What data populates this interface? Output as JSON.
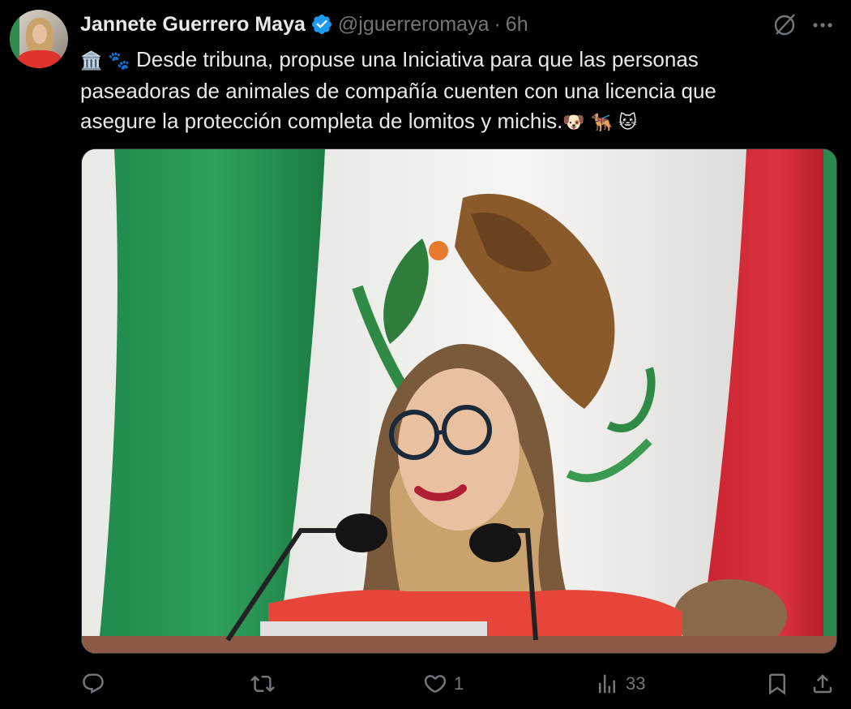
{
  "author": {
    "name": "Jannete Guerrero Maya",
    "handle": "@jguerreromaya",
    "separator": "·",
    "time": "6h"
  },
  "tweet": {
    "lead_emojis": "🏛️ 🐾",
    "line1": "Desde tribuna, propuse una Iniciativa para que las personas",
    "line2": "paseadoras de animales de compañía cuenten con una licencia que",
    "line3": "asegure la protección completa de lomitos y michis.",
    "trail_emojis": "🐶 🐕‍🦺 🐱"
  },
  "actions": {
    "replies": "",
    "reposts": "",
    "likes": "1",
    "views": "33"
  },
  "icons": {
    "verified": "verified-badge-icon",
    "grok": "grok-icon",
    "more": "more-icon",
    "reply": "reply-icon",
    "repost": "repost-icon",
    "like": "like-icon",
    "views": "views-icon",
    "bookmark": "bookmark-icon",
    "share": "share-icon"
  },
  "colors": {
    "background": "#000000",
    "text": "#e7e9ea",
    "muted": "#71767b",
    "verified": "#1d9bf0"
  }
}
